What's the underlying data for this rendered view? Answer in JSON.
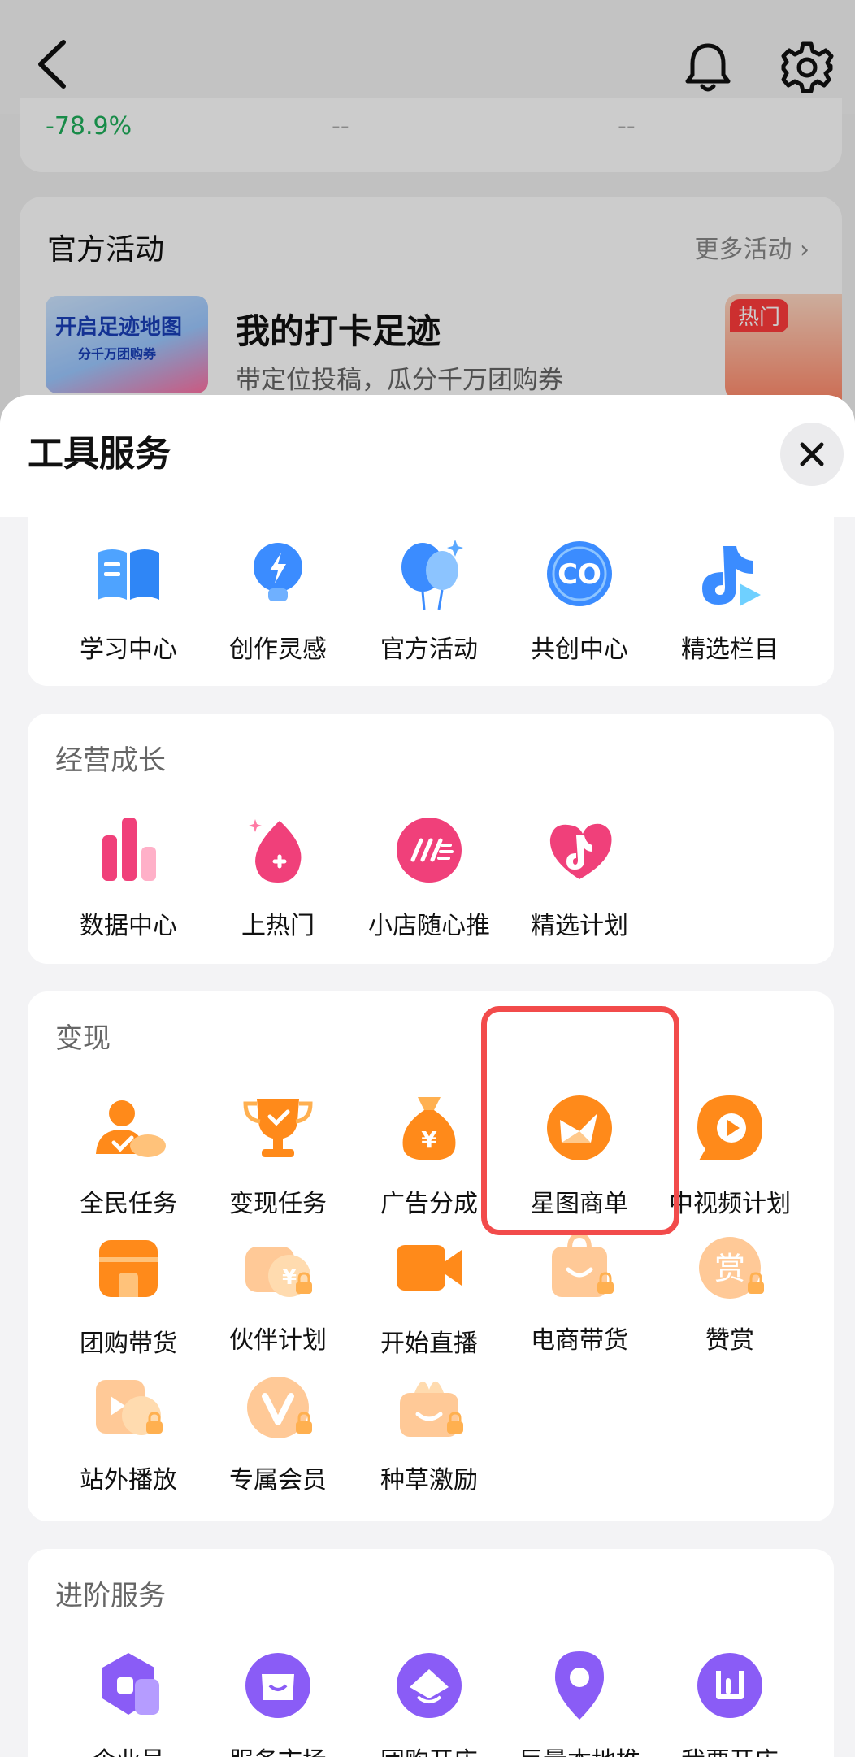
{
  "background": {
    "stats": [
      "-78.9%",
      "--",
      "--"
    ],
    "activity_card": {
      "title": "官方活动",
      "more": "更多活动",
      "thumb_title": "开启足迹地图",
      "thumb_sub": "分千万团购券",
      "name": "我的打卡足迹",
      "desc": "带定位投稿，瓜分千万团购券",
      "hot_badge": "热门"
    }
  },
  "sheet": {
    "title": "工具服务",
    "sections": {
      "top": {
        "items": [
          {
            "label": "学习中心",
            "icon": "book-icon"
          },
          {
            "label": "创作灵感",
            "icon": "lightbulb-icon"
          },
          {
            "label": "官方活动",
            "icon": "balloon-icon"
          },
          {
            "label": "共创中心",
            "icon": "co-icon"
          },
          {
            "label": "精选栏目",
            "icon": "douyin-play-icon"
          }
        ]
      },
      "growth": {
        "title": "经营成长",
        "items": [
          {
            "label": "数据中心",
            "icon": "bar-chart-icon"
          },
          {
            "label": "上热门",
            "icon": "flame-plus-icon"
          },
          {
            "label": "小店随心推",
            "icon": "speed-icon"
          },
          {
            "label": "精选计划",
            "icon": "douyin-heart-icon"
          }
        ]
      },
      "monetize": {
        "title": "变现",
        "items": [
          {
            "label": "全民任务",
            "icon": "people-check-icon"
          },
          {
            "label": "变现任务",
            "icon": "trophy-icon"
          },
          {
            "label": "广告分成",
            "icon": "money-bag-icon"
          },
          {
            "label": "星图商单",
            "icon": "star-map-icon"
          },
          {
            "label": "中视频计划",
            "icon": "video-play-icon"
          },
          {
            "label": "团购带货",
            "icon": "store-icon"
          },
          {
            "label": "伙伴计划",
            "icon": "partner-coin-icon",
            "locked": true
          },
          {
            "label": "开始直播",
            "icon": "live-camera-icon"
          },
          {
            "label": "电商带货",
            "icon": "shopping-bag-icon",
            "locked": true
          },
          {
            "label": "赞赏",
            "icon": "reward-icon",
            "locked": true
          },
          {
            "label": "站外播放",
            "icon": "external-play-icon",
            "locked": true
          },
          {
            "label": "专属会员",
            "icon": "vip-icon",
            "locked": true
          },
          {
            "label": "种草激励",
            "icon": "gift-box-icon",
            "locked": true
          }
        ],
        "reward_glyph": "赏",
        "yen_glyph": "¥"
      },
      "advanced": {
        "title": "进阶服务",
        "items": [
          {
            "label": "企业号",
            "icon": "enterprise-icon"
          },
          {
            "label": "服务市场",
            "icon": "market-icon"
          },
          {
            "label": "团购开店",
            "icon": "group-store-icon"
          },
          {
            "label": "巨量本地推",
            "icon": "location-pin-icon"
          },
          {
            "label": "我要开店",
            "icon": "open-store-icon"
          }
        ]
      }
    }
  },
  "colors": {
    "accent_orange": "#ff8a1a",
    "growth_pink": "#f0407a",
    "tool_blue": "#3b8cff",
    "advanced_purple": "#8a5cf6",
    "highlight_red": "#f24b4b",
    "stat_green": "#1fae5b"
  }
}
